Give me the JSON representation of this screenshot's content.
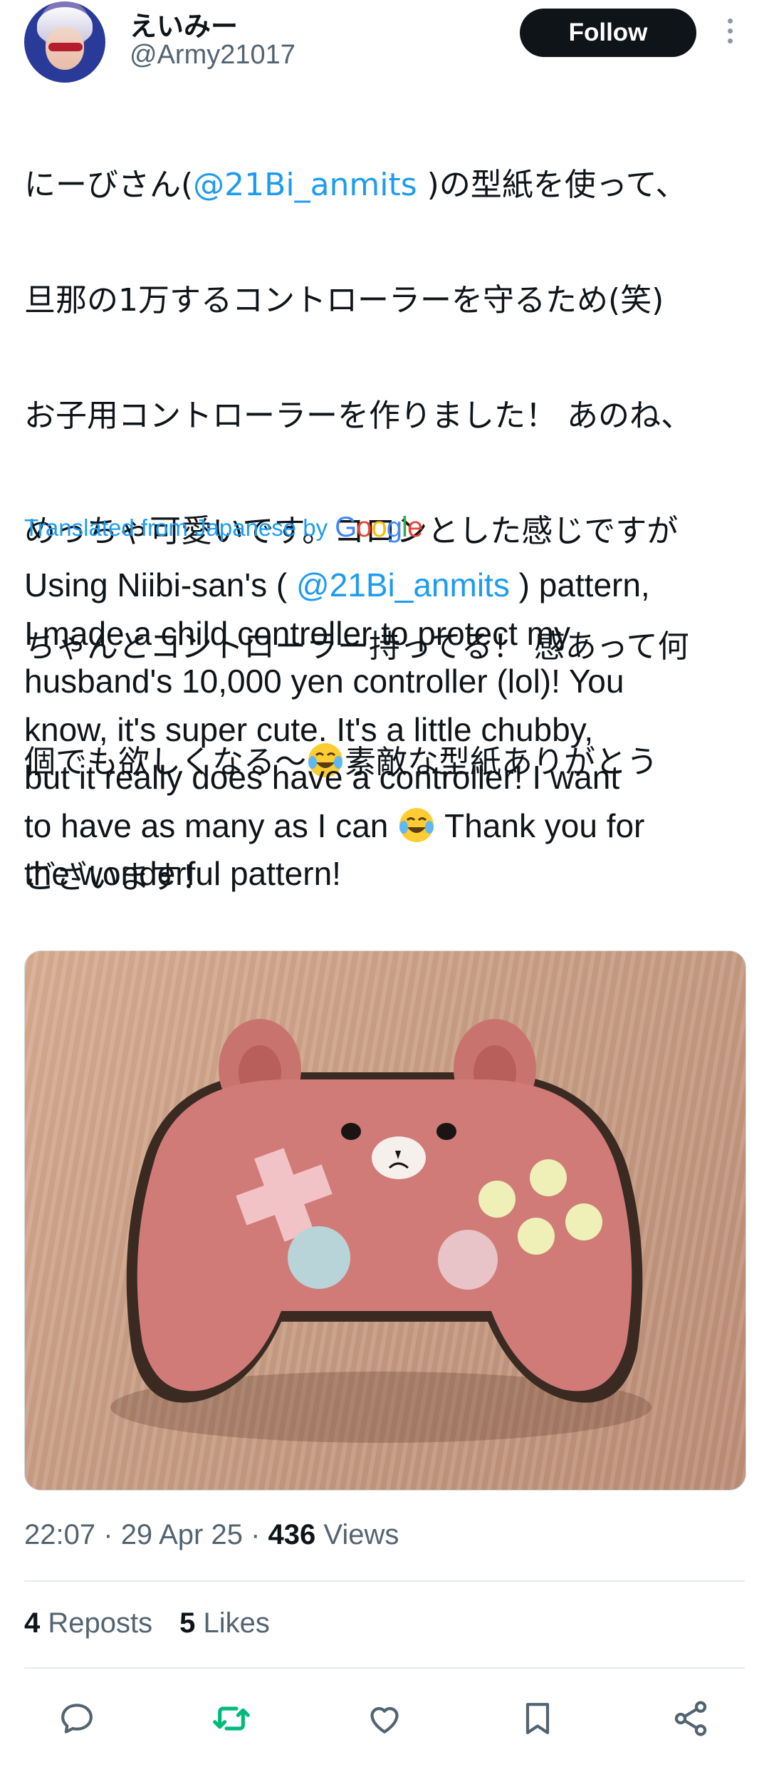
{
  "author": {
    "display_name": "えいみー",
    "handle": "@Army21017"
  },
  "header": {
    "follow_label": "Follow"
  },
  "tweet": {
    "jp_lines": [
      [
        "にーびさん(",
        "@21Bi_anmits",
        " )の型紙を使って、"
      ],
      [
        "旦那の1万するコントローラーを守るため(笑)"
      ],
      [
        "お子用コントローラーを作りました！ あのね、"
      ],
      [
        "めっちゃ可愛いです。コロンとした感じですが"
      ],
      [
        "ちゃんとコントローラー持ってる！ 感あって何"
      ],
      [
        "個でも欲しくなる〜",
        "素敵な型紙ありがとう"
      ],
      [
        "ございます！"
      ]
    ],
    "translated_label": "Translated from Japanese by",
    "google_logo": "Google",
    "en_lines": [
      [
        "Using Niibi-san's ( ",
        "@21Bi_anmits",
        " ) pattern,"
      ],
      [
        "I made a child controller to protect my"
      ],
      [
        "husband's 10,000 yen controller (lol)! You"
      ],
      [
        "know, it's super cute. It's a little chubby,"
      ],
      [
        "but it really does have a controller! I want"
      ],
      [
        "to have as many as I can ",
        " Thank you for"
      ],
      [
        "the wonderful pattern!"
      ]
    ],
    "mention_color": "#1d9bf0"
  },
  "meta": {
    "time": "22:07",
    "separator": "·",
    "date": "29 Apr 25",
    "views_count": "436",
    "views_label": "Views"
  },
  "stats": {
    "reposts_count": "4",
    "reposts_label": "Reposts",
    "likes_count": "5",
    "likes_label": "Likes"
  },
  "actions": [
    "reply-icon",
    "repost-icon",
    "like-icon",
    "bookmark-icon",
    "share-icon"
  ],
  "colors": {
    "repost_active": "#00ba7c",
    "action_gray": "#536471"
  }
}
